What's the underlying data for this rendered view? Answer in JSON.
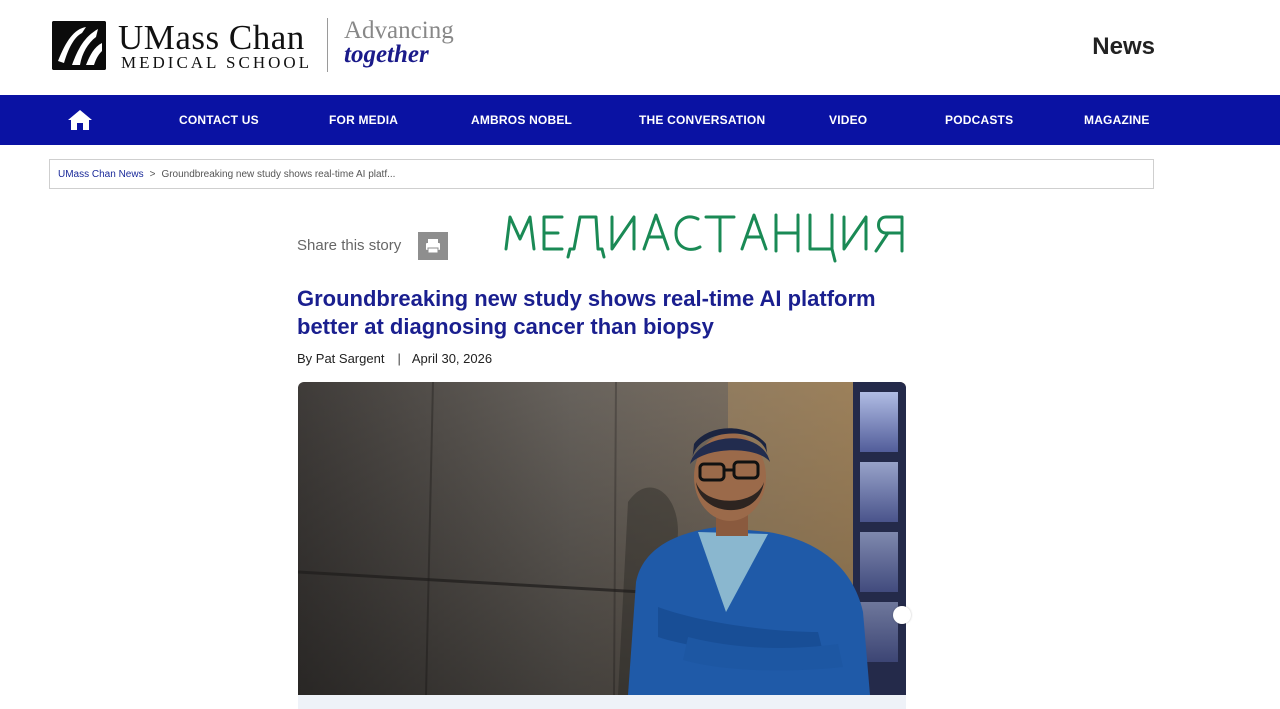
{
  "brand": {
    "name": "UMass Chan",
    "subname": "MEDICAL SCHOOL",
    "tagline_top": "Advancing",
    "tagline_bottom": "together",
    "section": "News"
  },
  "nav": {
    "home_icon": "home-icon",
    "items": [
      {
        "label": "CONTACT US"
      },
      {
        "label": "FOR MEDIA"
      },
      {
        "label": "AMBROS NOBEL"
      },
      {
        "label": "THE CONVERSATION"
      },
      {
        "label": "VIDEO"
      },
      {
        "label": "PODCASTS"
      },
      {
        "label": "MAGAZINE"
      }
    ],
    "color": "#0a12a3"
  },
  "breadcrumb": {
    "root": "UMass Chan News",
    "separator": ">",
    "current": "Groundbreaking new study shows real-time AI platf..."
  },
  "share": {
    "label": "Share this story",
    "print_icon": "printer-icon"
  },
  "overlay": {
    "handwritten_text": "МЕДИАСТАНЦИЯ",
    "color": "#1a8a55"
  },
  "article": {
    "title": "Groundbreaking new study shows real-time AI platform better at diagnosing cancer than biopsy",
    "author": "By Pat Sargent",
    "separator": "|",
    "date": "April 30, 2026",
    "title_color": "#1a1f8f"
  }
}
